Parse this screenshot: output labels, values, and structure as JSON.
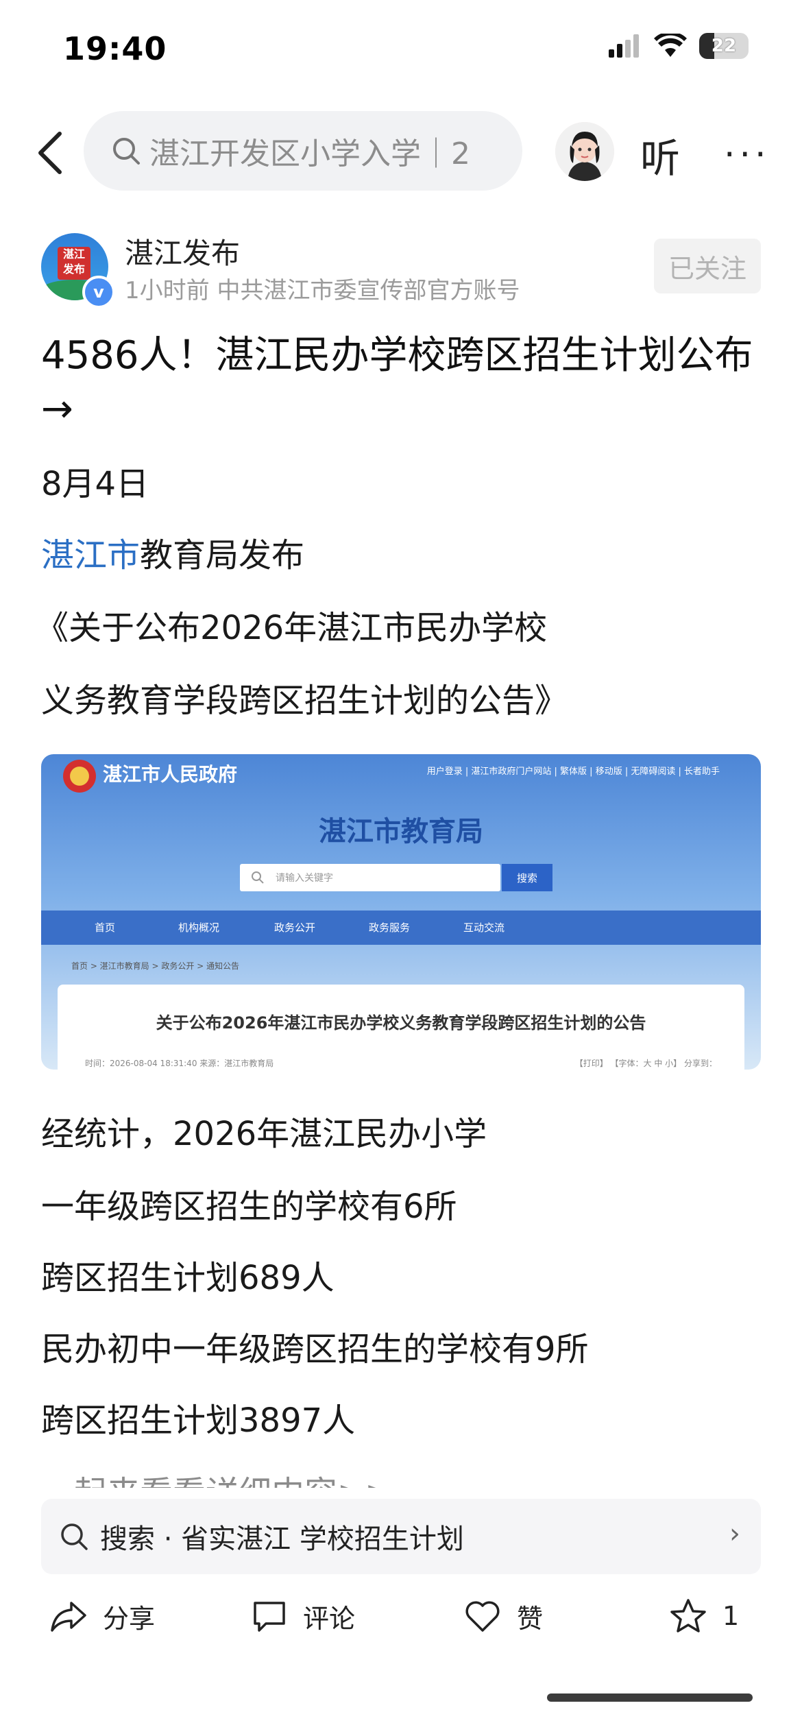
{
  "status_bar": {
    "time": "19:40",
    "battery": "22"
  },
  "header": {
    "search_text": "湛江开发区小学入学｜2",
    "listen_label": "听",
    "more_label": "···"
  },
  "author": {
    "name": "湛江发布",
    "meta": "1小时前   中共湛江市委宣传部官方账号",
    "follow_label": "已关注",
    "avatar_text": "湛江发布"
  },
  "article": {
    "title": "4586人！湛江民办学校跨区招生计划公布→",
    "date": "8月4日",
    "publisher_link": "湛江市",
    "publisher_rest": "教育局发布",
    "notice_line1": "《关于公布2026年湛江市民办学校",
    "notice_line2": "义务教育学段跨区招生计划的公告》",
    "body_lines": [
      "经统计，2026年湛江民办小学",
      "一年级跨区招生的学校有6所",
      "跨区招生计划689人",
      "民办初中一年级跨区招生的学校有9所",
      "跨区招生计划3897人"
    ],
    "faded_line": "一起来看看详细内容>>"
  },
  "embedded_screenshot": {
    "site_name": "湛江市人民政府",
    "top_links": "用户登录 | 湛江市政府门户网站 | 繁体版 | 移动版 | 无障碍阅读 | 长者助手",
    "heading": "湛江市教育局",
    "search_placeholder": "请输入关键字",
    "search_button": "搜索",
    "nav": [
      "首页",
      "机构概况",
      "政务公开",
      "政务服务",
      "互动交流"
    ],
    "breadcrumb": "首页 > 湛江市教育局 > 政务公开 > 通知公告",
    "notice_title": "关于公布2026年湛江市民办学校义务教育学段跨区招生计划的公告",
    "notice_meta": "时间：2026-08-04 18:31:40     来源：湛江市教育局",
    "notice_tools": "【打印】   【字体：大 中 小】   分享到："
  },
  "suggestion": {
    "text": "搜索 · 省实湛江 学校招生计划"
  },
  "actions": {
    "share": "分享",
    "comment": "评论",
    "like": "赞",
    "favorite_count": "1"
  }
}
